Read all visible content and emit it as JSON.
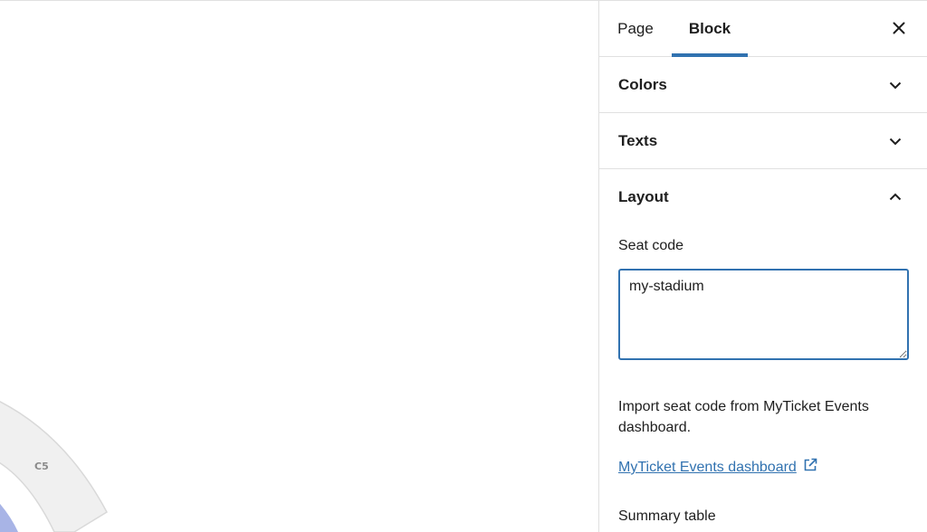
{
  "tabs": {
    "page_label": "Page",
    "block_label": "Block",
    "active": "Block"
  },
  "panels": {
    "colors_title": "Colors",
    "texts_title": "Texts",
    "layout_title": "Layout"
  },
  "layout": {
    "seat_code_label": "Seat code",
    "seat_code_value": "my-stadium",
    "help_text": "Import seat code from MyTicket Events dashboard.",
    "dashboard_link": "MyTicket Events dashboard",
    "summary_table_label": "Summary table"
  },
  "canvas": {
    "section_label": "C5"
  },
  "icons": {
    "close": "close-icon",
    "chevron_down": "chevron-down-icon",
    "chevron_up": "chevron-up-icon",
    "external_link": "external-link-icon"
  },
  "colors": {
    "accent": "#3172b0",
    "section_fill": "#f0f0f0",
    "section_stroke": "#d9d9d9",
    "field_fill": "#a8b4e6"
  }
}
